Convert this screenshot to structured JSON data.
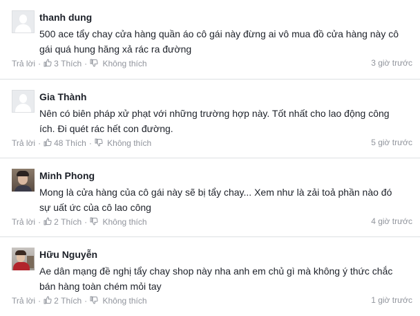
{
  "comments": [
    {
      "author": "thanh dung",
      "text": "500 ace tẩy chay cửa hàng quần áo cô gái này đừng ai vô mua đồ cửa hàng này cô gái quá hung hăng xả rác ra đường",
      "reply_label": "Trả lời",
      "like_count": "3",
      "like_label": "Thích",
      "dislike_label": "Không thích",
      "time": "3 giờ trước",
      "avatar": "default-avatar"
    },
    {
      "author": "Gia Thành",
      "text": "Nên có biên pháp xử phạt với những trường hợp này. Tốt nhất cho lao động công ích. Đi quét rác hết con đường.",
      "reply_label": "Trả lời",
      "like_count": "48",
      "like_label": "Thích",
      "dislike_label": "Không thích",
      "time": "5 giờ trước",
      "avatar": "default-avatar"
    },
    {
      "author": "Minh Phong",
      "text": "Mong là cửa hàng của cô gái này sẽ bị tẩy chay... Xem như là zải toả phần nào đó sự uất ức của cô lao công",
      "reply_label": "Trả lời",
      "like_count": "2",
      "like_label": "Thích",
      "dislike_label": "Không thích",
      "time": "4 giờ trước",
      "avatar": "photo-avatar"
    },
    {
      "author": "Hữu Nguyễn",
      "text": "Ae dân mạng đề nghị tẩy chay shop này nha anh em chủ gì mà không ý thức chắc bán hàng toàn chém mỏi tay",
      "reply_label": "Trả lời",
      "like_count": "2",
      "like_label": "Thích",
      "dislike_label": "Không thích",
      "time": "1 giờ trước",
      "avatar": "photo-avatar"
    }
  ],
  "colors": {
    "name": "#1d2129",
    "text": "#1d2129",
    "meta": "#90949c",
    "divider": "#dddfe2",
    "avatar_placeholder": "#e9ebee"
  }
}
